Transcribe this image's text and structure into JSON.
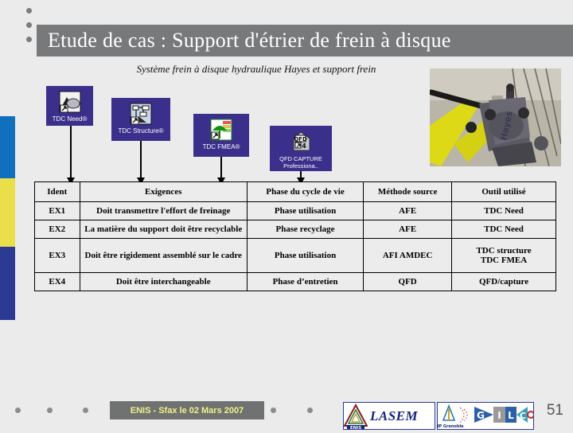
{
  "slide": {
    "title": "Etude de cas :  Support d'étrier de frein à disque",
    "subtitle": "Système frein à disque hydraulique Hayes et support frein",
    "page_number": "51",
    "accent_colors": {
      "title_bar": "#77797a",
      "bar_blue": "#1070be",
      "bar_yellow": "#eade4a",
      "bar_navy": "#2c3a94",
      "tile_blue": "#3b2f8c",
      "footer_banner": "#6f7270",
      "footer_text": "#f3f08a"
    }
  },
  "tiles": [
    {
      "label": "TDC Need®",
      "icon": "tdc-need-icon"
    },
    {
      "label": "TDC Structure®",
      "icon": "tdc-structure-icon"
    },
    {
      "label": "TDC FMEA®",
      "icon": "tdc-fmea-icon"
    },
    {
      "label": "QFD CAPTURE Professiona..",
      "icon": "qfd-capture-icon"
    }
  ],
  "table": {
    "headers": [
      "Ident",
      "Exigences",
      "Phase du cycle de vie",
      "Méthode source",
      "Outil utilisé"
    ],
    "rows": [
      {
        "ident": "EX1",
        "exigence": "Doit transmettre l'effort de freinage",
        "phase": "Phase utilisation",
        "methode": "AFE",
        "outil": "TDC Need"
      },
      {
        "ident": "EX2",
        "exigence": "La matière du support doit être recyclable",
        "phase": "Phase recyclage",
        "methode": "AFE",
        "outil": "TDC Need"
      },
      {
        "ident": "EX3",
        "exigence": "Doit être rigidement assemblé sur le cadre",
        "phase": "Phase utilisation",
        "methode": "AFI AMDEC",
        "outil": "TDC structure TDC FMEA",
        "outil_line1": "TDC structure",
        "outil_line2": "TDC FMEA"
      },
      {
        "ident": "EX4",
        "exigence": "Doit être interchangeable",
        "phase": "Phase d’entretien",
        "methode": "QFD",
        "outil": "QFD/capture"
      }
    ]
  },
  "footer": {
    "banner_text": "ENIS - Sfax le 02 Mars 2007",
    "logos": [
      {
        "name": "LASEM",
        "mark": "enis-triangle-logo"
      },
      {
        "name": "GILCO",
        "mark": "inp-grenoble-logo"
      }
    ]
  },
  "photo": {
    "caption": "Hayes hydraulic disc brake caliper on yellow bicycle frame"
  }
}
